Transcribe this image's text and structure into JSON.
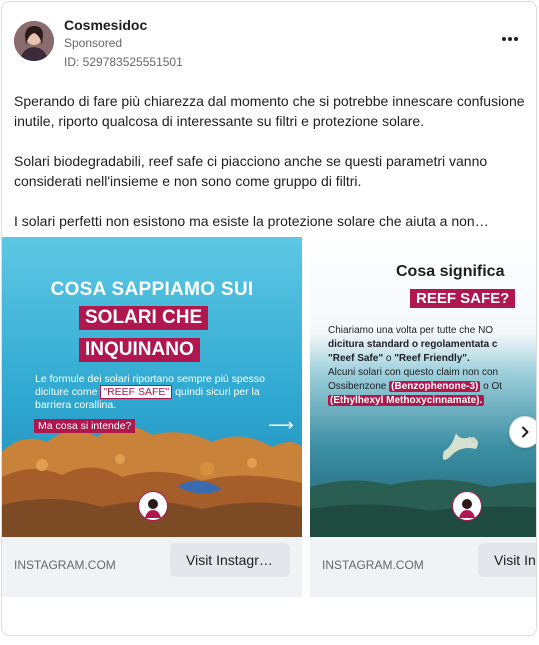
{
  "post": {
    "page_name": "Cosmesidoc",
    "sponsored": "Sponsored",
    "ad_id": "ID: 529783525551501",
    "body": [
      "Sperando di fare più chiarezza dal momento che si potrebbe innescare confusione inutile, riporto qualcosa di interessante su filtri e protezione solare.",
      "Solari biodegradabili, reef safe ci piacciono anche se questi parametri vanno considerati nell'insieme e non sono come gruppo di filtri.",
      "I solari perfetti non esistono ma esiste la protezione solare che aiuta a non…"
    ]
  },
  "cards": [
    {
      "title": "COSA SAPPIAMO SUI",
      "box1": "SOLARI CHE",
      "box2": "INQUINANO",
      "para_a": "Le formule dei solari riportano sempre più spesso diciture come ",
      "para_hl": "\"REEF SAFE\"",
      "para_b": " quindi sicuri per la barriera corallina.",
      "question": "Ma cosa si intende?",
      "arrow": "⟶",
      "domain": "INSTAGRAM.COM",
      "cta": "Visit Instagr…"
    },
    {
      "title": "Cosa significa",
      "box": "REEF SAFE?",
      "line1": "Chiariamo una volta per tutte che NO",
      "line2": "dicitura standard o regolamentata c",
      "line3a": "\"Reef Safe\"",
      "line3b": " o ",
      "line3c": "\"Reef Friendly\".",
      "line4": "Alcuni solari con questo claim non con",
      "line5a": "Ossibenzone ",
      "line5b": "(Benzophenone-3)",
      "line5c": " o Ot",
      "line6": "(Ethylhexyl Methoxycinnamate).",
      "domain": "INSTAGRAM.COM",
      "cta": "Visit Ins"
    }
  ],
  "colors": {
    "accent": "#b0174f",
    "sea": "#3fb8d8",
    "card_bg": "#f0f2f5"
  },
  "icons": {
    "more": "more-horizontal-icon",
    "next": "chevron-right-icon"
  }
}
